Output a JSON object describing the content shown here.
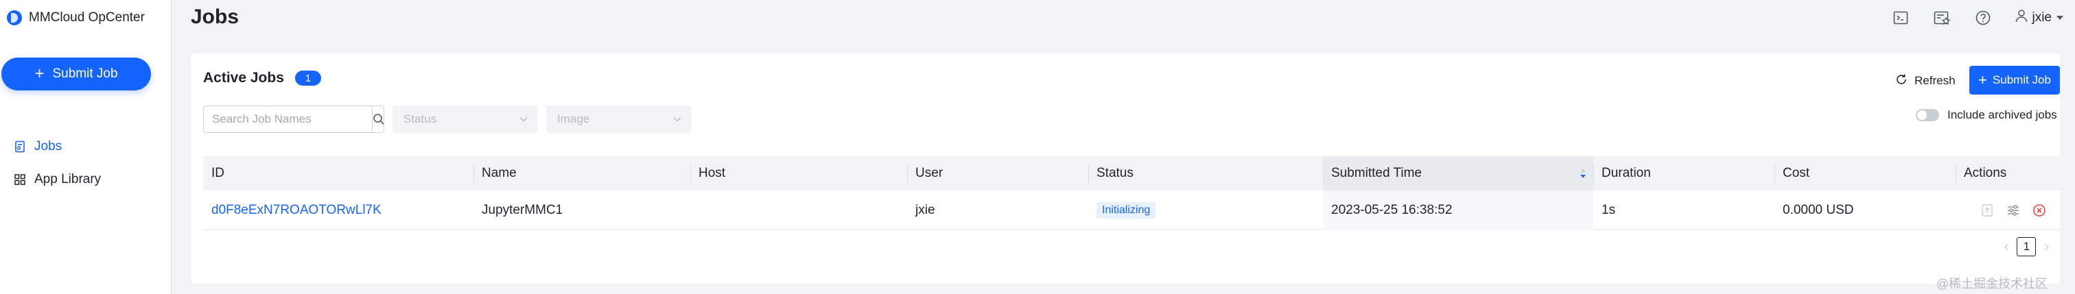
{
  "app": {
    "name": "MMCloud OpCenter",
    "submit_job_label": "Submit Job"
  },
  "sidebar": {
    "items": [
      {
        "label": "Jobs",
        "icon": "jobs-icon",
        "active": true
      },
      {
        "label": "App Library",
        "icon": "app-library-icon",
        "active": false
      }
    ]
  },
  "header": {
    "title": "Jobs",
    "icons": [
      "terminal-icon",
      "news-star-icon",
      "help-icon"
    ],
    "user": "jxie"
  },
  "card": {
    "title": "Active Jobs",
    "count": "1",
    "refresh_label": "Refresh",
    "submit_label": "Submit Job",
    "search_placeholder": "Search Job Names",
    "status_placeholder": "Status",
    "image_placeholder": "Image",
    "archived_label": "Include archived jobs",
    "archived_on": false
  },
  "table": {
    "columns": [
      "ID",
      "Name",
      "Host",
      "User",
      "Status",
      "Submitted Time",
      "Duration",
      "Cost",
      "Actions"
    ],
    "sorted_column": "Submitted Time",
    "rows": [
      {
        "id": "d0F8eExN7ROAOTORwLl7K",
        "name": "JupyterMMC1",
        "host": "",
        "user": "jxie",
        "status": "Initializing",
        "submitted_time": "2023-05-25 16:38:52",
        "duration": "1s",
        "cost": "0.0000 USD"
      }
    ]
  },
  "pagination": {
    "current_page": "1"
  },
  "watermark": "@稀土掘金技术社区",
  "colors": {
    "primary": "#1664ff",
    "danger": "#f53f3f",
    "background": "#f2f3f5"
  }
}
